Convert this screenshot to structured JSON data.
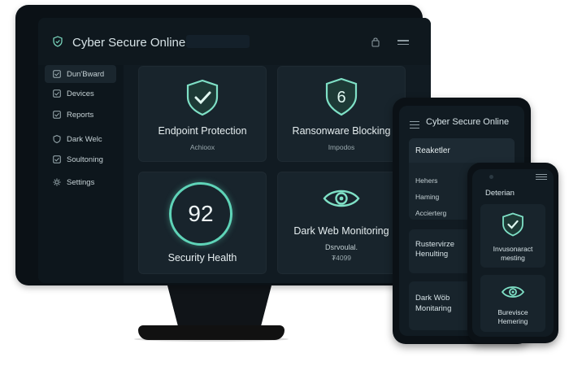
{
  "monitor": {
    "app_title": "Cyber Secure Online",
    "sidebar": {
      "items": [
        {
          "label": "Dun'Bward",
          "icon": "checkbox-icon",
          "active": true
        },
        {
          "label": "Devices",
          "icon": "checkbox-icon",
          "active": false
        },
        {
          "label": "Reports",
          "icon": "checkbox-icon",
          "active": false
        },
        {
          "label": "Dark Welc",
          "icon": "shield-icon",
          "active": false
        },
        {
          "label": "Soultoning",
          "icon": "checkbox-icon",
          "active": false
        },
        {
          "label": "Settings",
          "icon": "gear-icon",
          "active": false
        }
      ]
    },
    "cards": {
      "endpoint": {
        "title": "Endpoint Protection",
        "status": "Achioox",
        "icon": "shield-check-icon"
      },
      "ransomware": {
        "title": "Ransonware Blocking",
        "status": "Impodos",
        "icon": "shield-six-icon",
        "badge": "6"
      },
      "health": {
        "score": "92",
        "title": "Security Health"
      },
      "darkweb": {
        "title": "Dark Web Monitoring",
        "status_line1": "Dsrvoulal.",
        "status_line2": "₮4099",
        "icon": "eye-icon"
      }
    }
  },
  "tablet": {
    "app_title": "Cyber Secure Online",
    "header_card": "Reaketler",
    "list_items": [
      "Hehers",
      "Haming",
      "Accierterg"
    ],
    "card_a": {
      "line1": "Rustervirze",
      "line2": "Henulting"
    },
    "card_b": {
      "line1": "Dark Wöb",
      "line2": "Monitaring"
    }
  },
  "phone": {
    "title": "Deterian",
    "card_a": {
      "line1": "Invusonaract",
      "line2": "mesting",
      "icon": "shield-check-icon"
    },
    "card_b": {
      "line1": "Burevisce",
      "line2": "Hemering",
      "icon": "eye-icon"
    }
  },
  "colors": {
    "accent": "#5fd4b8",
    "background": "#111b22",
    "card": "#18242c"
  }
}
